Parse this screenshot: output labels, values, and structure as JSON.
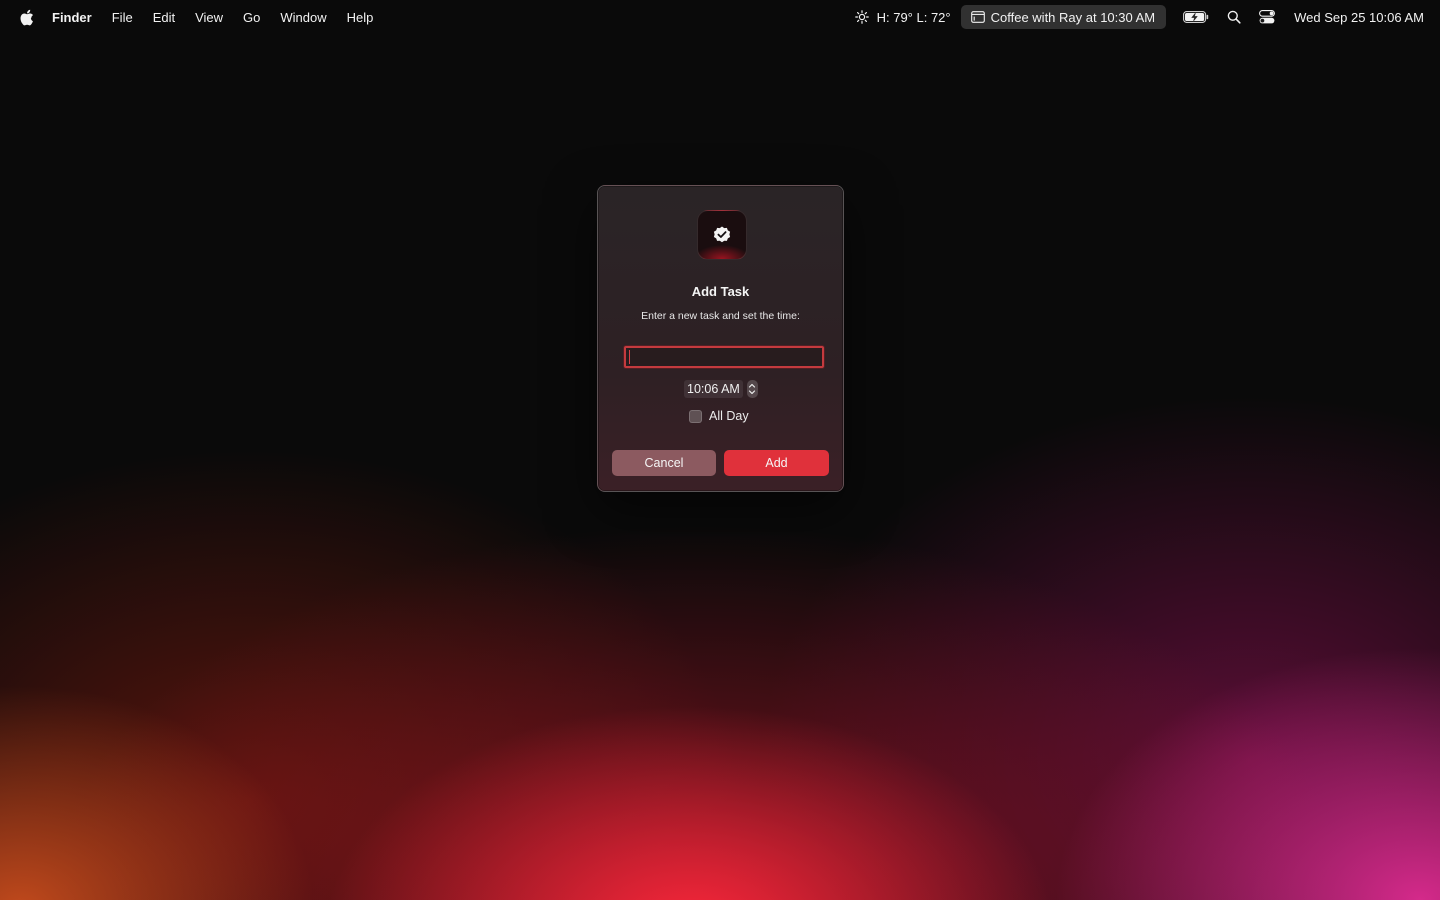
{
  "menubar": {
    "apple_icon": "apple-logo-icon",
    "app_name": "Finder",
    "menus": [
      "File",
      "Edit",
      "View",
      "Go",
      "Window",
      "Help"
    ],
    "weather": {
      "icon": "sun-icon",
      "text": "H: 79° L: 72°"
    },
    "next_event": {
      "icon": "calendar-icon",
      "text": "Coffee with Ray at 10:30 AM"
    },
    "battery_icon": "battery-charging-icon",
    "search_icon": "spotlight-search-icon",
    "control_center_icon": "control-center-icon",
    "clock": "Wed Sep 25  10:06 AM"
  },
  "dialog": {
    "app_icon": "checkmark-badge-icon",
    "title": "Add Task",
    "subtitle": "Enter a new task and set the time:",
    "task_input": {
      "value": "",
      "placeholder": ""
    },
    "time": "10:06 AM",
    "all_day_label": "All Day",
    "all_day_checked": false,
    "cancel_label": "Cancel",
    "add_label": "Add"
  },
  "colors": {
    "accent": "#e0313b",
    "cancel_button": "#8c5a60",
    "input_focus_ring": "#c43a3e"
  }
}
